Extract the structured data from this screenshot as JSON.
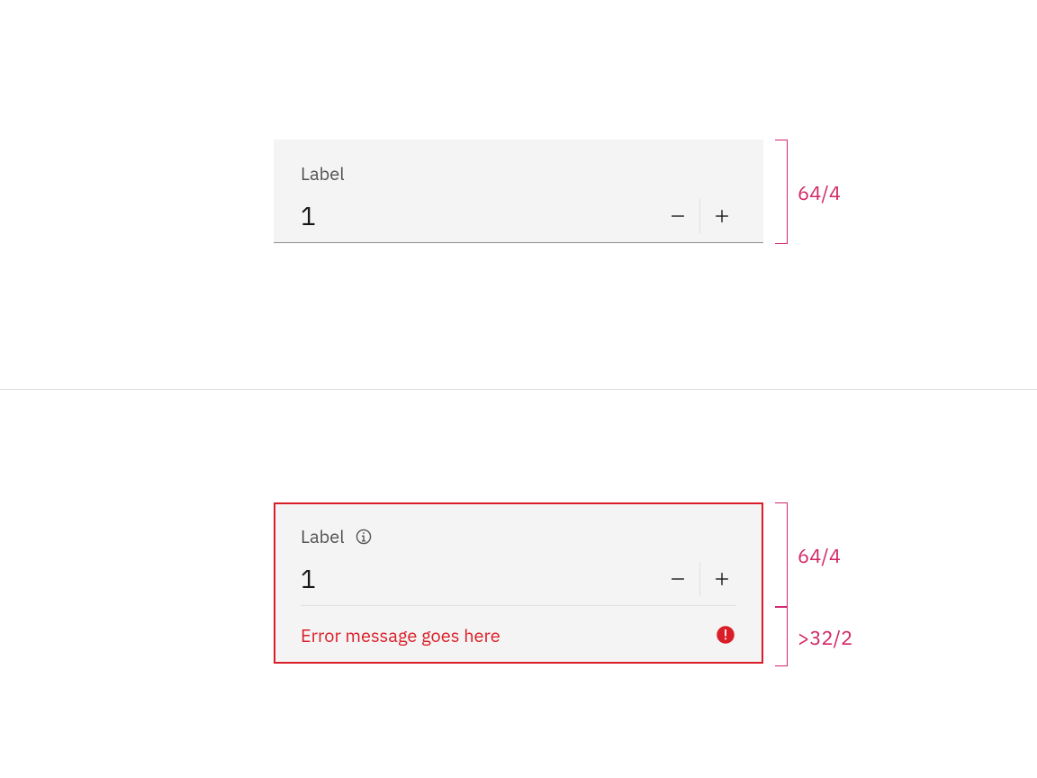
{
  "example_default": {
    "label": "Label",
    "value": "1",
    "spec_height": "64/4"
  },
  "example_invalid": {
    "label": "Label",
    "value": "1",
    "error_message": "Error message goes here",
    "spec_height": "64/4",
    "spec_error_height": ">32/2"
  },
  "colors": {
    "spec": "#d12771",
    "error": "#da1e28",
    "field_bg": "#f4f4f4",
    "label_text": "#525252"
  }
}
